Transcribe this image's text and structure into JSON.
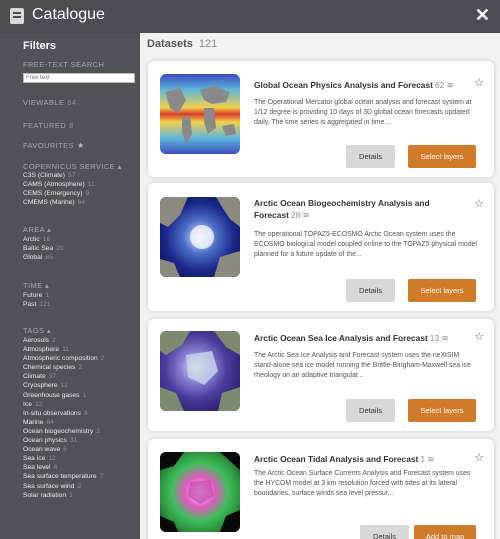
{
  "header": {
    "title": "Catalogue",
    "close": "✕"
  },
  "filters": {
    "title": "Filters",
    "search": {
      "label": "FREE-TEXT SEARCH",
      "placeholder": "Free text"
    },
    "viewable": {
      "label": "VIEWABLE",
      "count": "64"
    },
    "featured": {
      "label": "FEATURED",
      "count": "8"
    },
    "favourites": {
      "label": "FAVOURITES",
      "icon": "★"
    },
    "copernicus": {
      "label": "COPERNICUS SERVICE ▴",
      "items": [
        {
          "name": "C3S (Climate)",
          "count": "37"
        },
        {
          "name": "CAMS (Atmosphere)",
          "count": "11"
        },
        {
          "name": "CEMS (Emergency)",
          "count": "9"
        },
        {
          "name": "CMEMS (Marine)",
          "count": "64"
        }
      ]
    },
    "area": {
      "label": "AREA ▴",
      "items": [
        {
          "name": "Arctic",
          "count": "16"
        },
        {
          "name": "Baltic Sea",
          "count": "20"
        },
        {
          "name": "Global",
          "count": "85"
        }
      ]
    },
    "time": {
      "label": "TIME ▴",
      "items": [
        {
          "name": "Future",
          "count": "1"
        },
        {
          "name": "Past",
          "count": "121"
        }
      ]
    },
    "tags": {
      "label": "TAGS ▴",
      "items": [
        {
          "name": "Aerosols",
          "count": "2"
        },
        {
          "name": "Atmosphere",
          "count": "11"
        },
        {
          "name": "Atmospheric composition",
          "count": "2"
        },
        {
          "name": "Chemical species",
          "count": "2"
        },
        {
          "name": "Climate",
          "count": "37"
        },
        {
          "name": "Cryosphere",
          "count": "12"
        },
        {
          "name": "Greenhouse gases",
          "count": "1"
        },
        {
          "name": "Ice",
          "count": "12"
        },
        {
          "name": "In-situ observations",
          "count": "4"
        },
        {
          "name": "Marine",
          "count": "64"
        },
        {
          "name": "Ocean biogeochemistry",
          "count": "2"
        },
        {
          "name": "Ocean physics",
          "count": "31"
        },
        {
          "name": "Ocean wave",
          "count": "5"
        },
        {
          "name": "Sea ice",
          "count": "12"
        },
        {
          "name": "Sea level",
          "count": "4"
        },
        {
          "name": "Sea surface temperature",
          "count": "7"
        },
        {
          "name": "Sea surface wind",
          "count": "2"
        },
        {
          "name": "Solar radiation",
          "count": "1"
        }
      ]
    }
  },
  "datasets": {
    "title": "Datasets",
    "count": "121",
    "cards": [
      {
        "title": "Global Ocean Physics Analysis and Forecast",
        "layers": "62",
        "desc": "The Operational Mercator global ocean analysis and forecast system at 1/12 degree is providing 10 days of 3D global ocean forecasts updated daily. The time series is aggregated in time...",
        "details": "Details",
        "action": "Select layers"
      },
      {
        "title": "Arctic Ocean Biogeochemistry Analysis and Forecast",
        "layers": "28",
        "desc": "The operational TOPAZ5-ECOSMO Arctic Ocean system uses the ECOSMO biological model coupled online to the TOPAZ5 physical model planned for a future update of the...",
        "details": "Details",
        "action": "Select layers"
      },
      {
        "title": "Arctic Ocean Sea Ice Analysis and Forecast",
        "layers": "13",
        "desc": "The Arctic Sea Ice Analysis and Forecast system uses the neXtSIM stand-alone sea ice model running the Brittle-Bingham-Maxwell sea ice rheology on an adaptive triangular...",
        "details": "Details",
        "action": "Select layers"
      },
      {
        "title": "Arctic Ocean Tidal Analysis and Forecast",
        "layers": "1",
        "desc": "The Arctic Ocean Surface Currents Analysis and Forecast system uses the HYCOM model at 3 km resolution forced with tides at its lateral boundaries, surface winds sea level pressur...",
        "details": "Details",
        "action": "Add to map"
      }
    ]
  },
  "colors": {
    "accent": "#d07a2a",
    "sidebar": "#4f5357",
    "header": "#4a4e52"
  }
}
